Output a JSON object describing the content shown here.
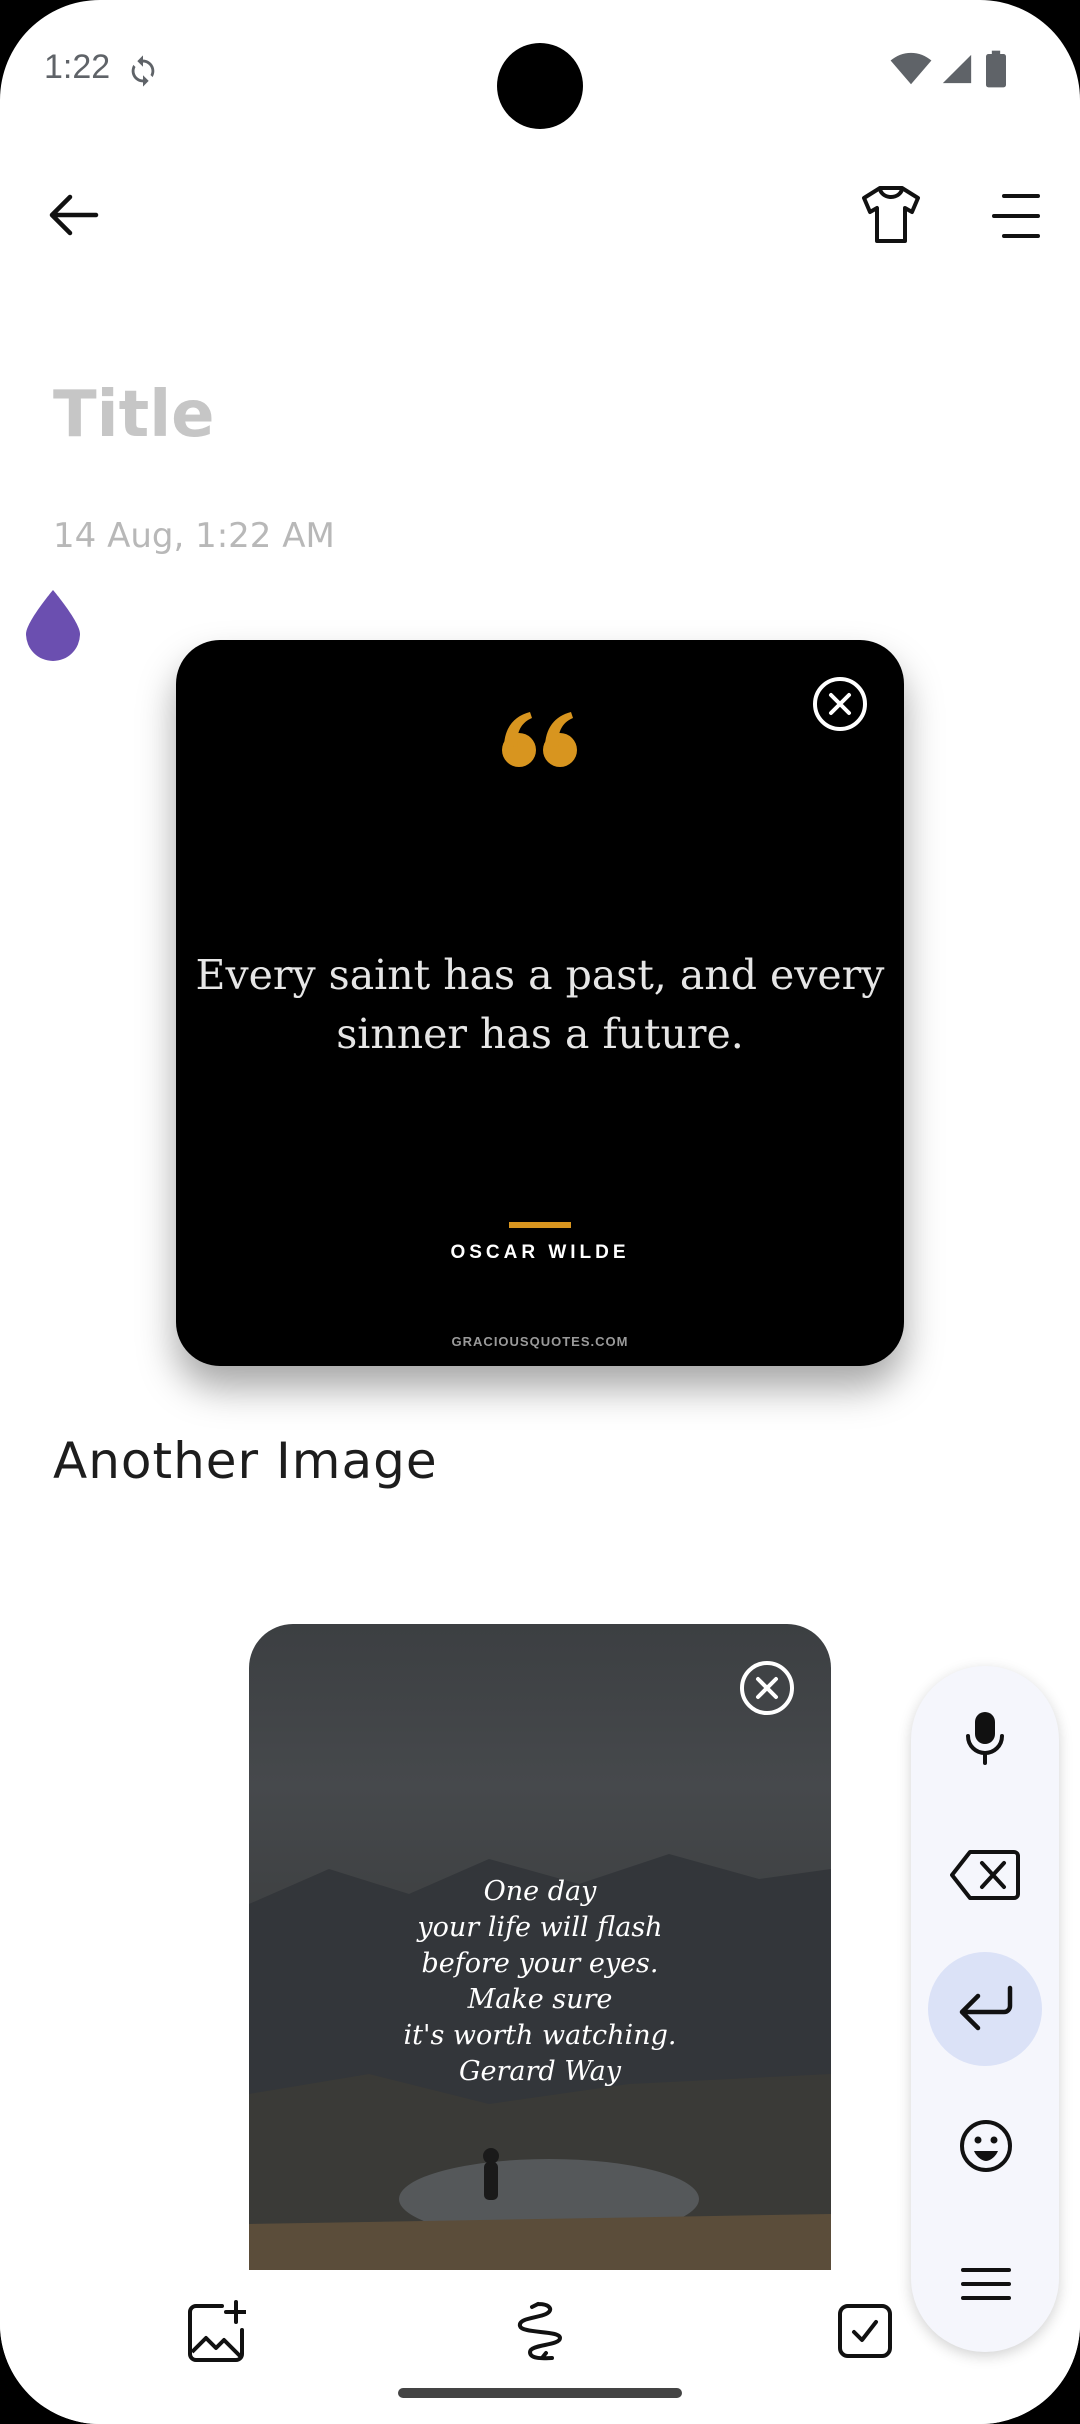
{
  "status_bar": {
    "time": "1:22"
  },
  "note": {
    "title_placeholder": "Title",
    "date": "14 Aug, 1:22  AM",
    "color_drop": "#6b4fb0"
  },
  "images": [
    {
      "quote": "Every saint has a past, and every sinner has a future.",
      "author": "OSCAR WILDE",
      "source": "GRACIOUSQUOTES.COM",
      "accent": "#d8951f"
    },
    {
      "lines": [
        "One day",
        "your life will flash",
        "before your eyes.",
        "Make sure",
        "it's worth watching.",
        "Gerard Way"
      ]
    }
  ],
  "caption": "Another  Image",
  "icons": {
    "back": "arrow-left-icon",
    "theme": "tshirt-icon",
    "menu": "menu-icon",
    "mic": "microphone-icon",
    "backspace": "backspace-icon",
    "enter": "enter-icon",
    "emoji": "emoji-icon",
    "more": "hamburger-icon",
    "add_image": "add-image-icon",
    "draw": "scribble-icon",
    "checklist": "checkbox-icon"
  }
}
